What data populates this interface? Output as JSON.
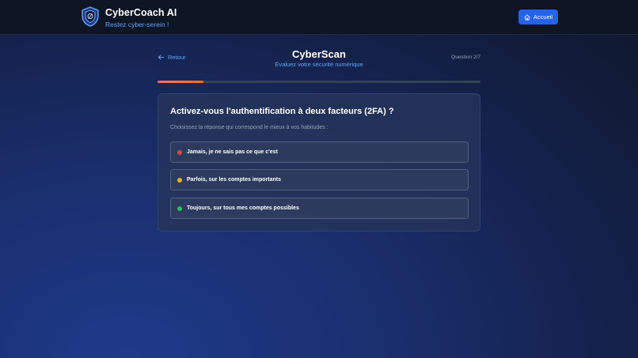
{
  "header": {
    "brand_title": "CyberCoach AI",
    "brand_subtitle": "Restez cyber-serein !",
    "home_label": "Accueil"
  },
  "nav": {
    "back_label": "Retour",
    "title": "CyberScan",
    "subtitle": "Évaluez votre sécurité numérique",
    "question_counter": "Question 2/7",
    "progress_fraction": 0.143
  },
  "quiz": {
    "question": "Activez-vous l'authentification à deux facteurs (2FA) ?",
    "instruction": "Choisissez la réponse qui correspond le mieux à vos habitudes :",
    "options": [
      {
        "label": "Jamais, je ne sais pas ce que c'est",
        "color": "#ef4444"
      },
      {
        "label": "Parfois, sur les comptes importants",
        "color": "#eab308"
      },
      {
        "label": "Toujours, sur tous mes comptes possibles",
        "color": "#22c55e"
      }
    ]
  },
  "colors": {
    "accent": "#2563eb",
    "link": "#60a5fa",
    "progress": "#f87171"
  },
  "icons": {
    "logo": "shield-icon",
    "home": "home-icon",
    "back": "arrow-left-icon"
  }
}
